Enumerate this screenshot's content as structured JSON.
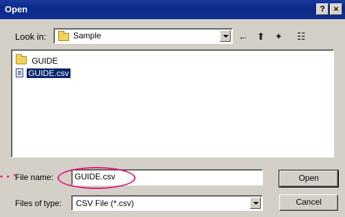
{
  "window": {
    "title": "Open",
    "help_label": "?",
    "close_label": "×"
  },
  "lookin": {
    "label": "Look in:",
    "value": "Sample"
  },
  "toolbar": {
    "back_icon": "←",
    "up_icon": "⬆",
    "newfolder_icon": "✦",
    "views_icon": "☷"
  },
  "files": [
    {
      "name": "GUIDE",
      "kind": "folder"
    },
    {
      "name": "GUIDE.csv",
      "kind": "csv-file"
    }
  ],
  "filename": {
    "label": "File name:",
    "value": "GUIDE.csv"
  },
  "filetype": {
    "label": "Files of type:",
    "value": "CSV File (*.csv)"
  },
  "buttons": {
    "open_label": "Open",
    "cancel_label": "Cancel"
  },
  "annotation": {
    "marker": "• • *"
  },
  "colors": {
    "titlebar": "#0a2a8a",
    "dialog_face": "#d4d0c8",
    "selection": "#0a246a",
    "highlight_circle": "#e0197a"
  }
}
